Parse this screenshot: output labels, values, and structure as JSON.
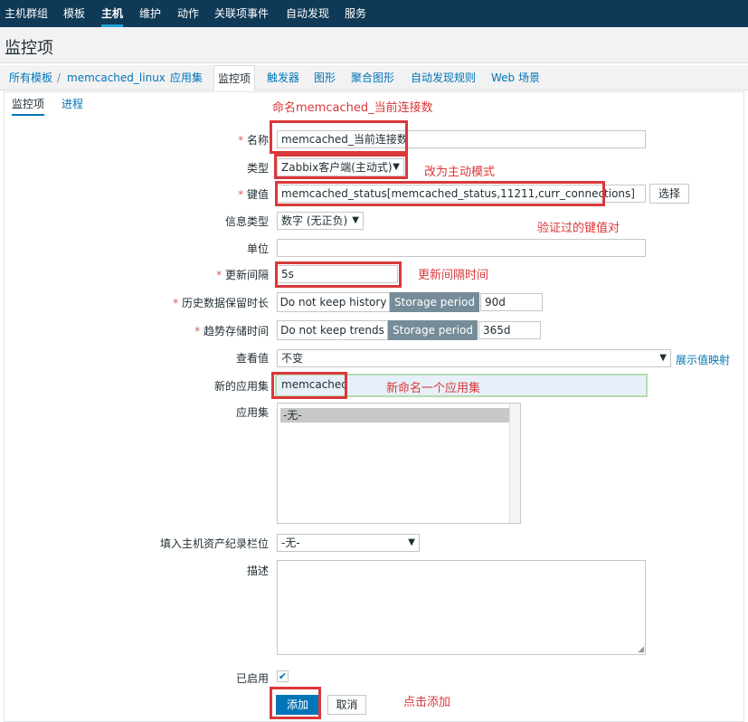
{
  "topnav": {
    "items": [
      "主机群组",
      "模板",
      "主机",
      "维护",
      "动作",
      "关联项事件",
      "自动发现",
      "服务"
    ],
    "active_index": 2
  },
  "header": {
    "title": "监控项"
  },
  "breadcrumbs": {
    "items": [
      "所有模板",
      "/",
      "memcached_linux",
      "应用集",
      "监控项",
      "触发器",
      "图形",
      "聚合图形",
      "自动发现规则",
      "Web 场景"
    ]
  },
  "tabs": {
    "items": [
      "监控项",
      "进程"
    ]
  },
  "form": {
    "required_mark": "*",
    "name_label": "名称",
    "name_value": "memcached_当前连接数",
    "type_label": "类型",
    "type_value": "Zabbix客户端(主动式)",
    "key_label": "键值",
    "key_value": "memcached_status[memcached_status,11211,curr_connections]",
    "select_button": "选择",
    "info_type_label": "信息类型",
    "info_type_value": "数字 (无正负)",
    "units_label": "单位",
    "units_value": "",
    "interval_label": "更新间隔",
    "interval_value": "5s",
    "history_label": "历史数据保留时长",
    "history_off": "Do not keep history",
    "history_on": "Storage period",
    "history_value": "90d",
    "trends_label": "趋势存储时间",
    "trends_off": "Do not keep trends",
    "trends_on": "Storage period",
    "trends_value": "365d",
    "valuemap_label": "查看值",
    "valuemap_value": "不变",
    "valuemap_link": "展示值映射",
    "new_app_label": "新的应用集",
    "new_app_value": "memcached",
    "apps_label": "应用集",
    "apps_option": "-无-",
    "inventory_label": "填入主机资产纪录栏位",
    "inventory_value": "-无-",
    "desc_label": "描述",
    "desc_value": "",
    "enabled_label": "已启用",
    "enabled": true,
    "add_button": "添加",
    "cancel_button": "取消"
  },
  "annotations": {
    "name_note": "命名memcached_当前连接数",
    "type_note": "改为主动模式",
    "key_note": "验证过的键值对",
    "interval_note": "更新间隔时间",
    "app_note": "新命名一个应用集",
    "add_note": "点击添加"
  },
  "colors": {
    "nav_bg": "#0f3a57",
    "accent": "#0275b8",
    "annotation_red": "#d9383a",
    "segment_active": "#768d99",
    "highlight_green": "#b5dcb0"
  }
}
